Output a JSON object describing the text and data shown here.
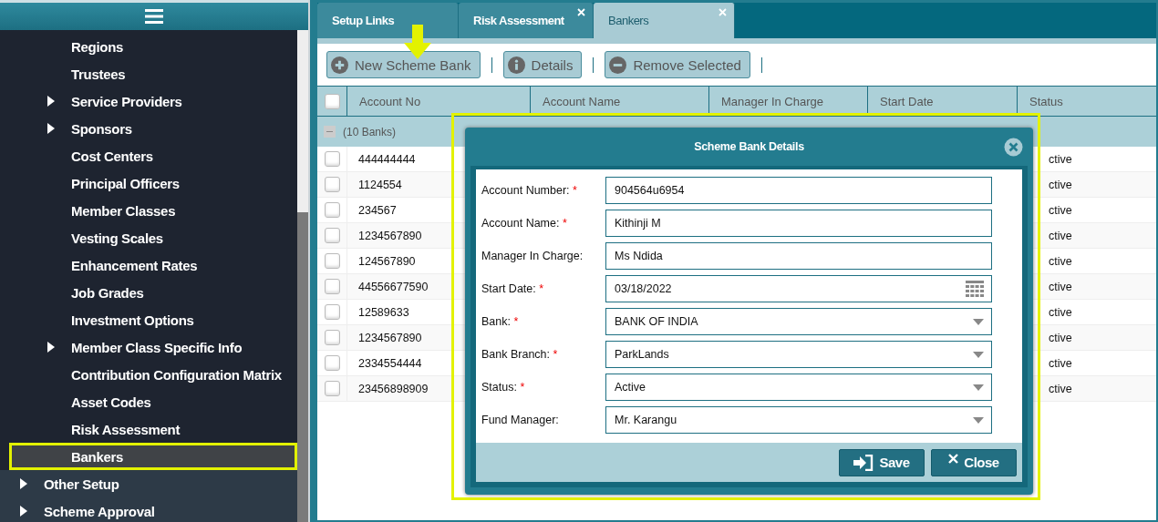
{
  "sidebar": {
    "sub_items": [
      {
        "label": "Regions",
        "expandable": false,
        "selected": false
      },
      {
        "label": "Trustees",
        "expandable": false,
        "selected": false
      },
      {
        "label": "Service Providers",
        "expandable": true,
        "selected": false
      },
      {
        "label": "Sponsors",
        "expandable": true,
        "selected": false
      },
      {
        "label": "Cost Centers",
        "expandable": false,
        "selected": false
      },
      {
        "label": "Principal Officers",
        "expandable": false,
        "selected": false
      },
      {
        "label": "Member Classes",
        "expandable": false,
        "selected": false
      },
      {
        "label": "Vesting Scales",
        "expandable": false,
        "selected": false
      },
      {
        "label": "Enhancement Rates",
        "expandable": false,
        "selected": false
      },
      {
        "label": "Job Grades",
        "expandable": false,
        "selected": false
      },
      {
        "label": "Investment Options",
        "expandable": false,
        "selected": false
      },
      {
        "label": "Member Class Specific Info",
        "expandable": true,
        "selected": false
      },
      {
        "label": "Contribution Configuration Matrix",
        "expandable": false,
        "selected": false
      },
      {
        "label": "Asset Codes",
        "expandable": false,
        "selected": false
      },
      {
        "label": "Risk Assessment",
        "expandable": false,
        "selected": false
      },
      {
        "label": "Bankers",
        "expandable": false,
        "selected": true
      }
    ],
    "items": [
      {
        "label": "Other Setup",
        "expandable": true
      },
      {
        "label": "Scheme Approval",
        "expandable": true
      }
    ]
  },
  "tabs": [
    {
      "label": "Setup Links",
      "closable": false,
      "selected": false
    },
    {
      "label": "Risk Assessment",
      "closable": true,
      "selected": false
    },
    {
      "label": "Bankers",
      "closable": true,
      "selected": true
    }
  ],
  "toolbar": [
    {
      "label": "New Scheme Bank",
      "kind": "add"
    },
    {
      "label": "Details",
      "kind": "info"
    },
    {
      "label": "Remove Selected",
      "kind": "remove"
    }
  ],
  "table": {
    "select_all_checked": false,
    "columns": [
      "Account No",
      "Account Name",
      "Manager In Charge",
      "Start Date",
      "Status"
    ],
    "group": "(10 Banks)",
    "rows": [
      {
        "account_no": "444444444",
        "status": "ctive",
        "checked": false
      },
      {
        "account_no": "1124554",
        "status": "ctive",
        "checked": false
      },
      {
        "account_no": "234567",
        "status": "ctive",
        "checked": false
      },
      {
        "account_no": "1234567890",
        "status": "ctive",
        "checked": false
      },
      {
        "account_no": "124567890",
        "status": "ctive",
        "checked": false
      },
      {
        "account_no": "44556677590",
        "status": "ctive",
        "checked": false
      },
      {
        "account_no": "12589633",
        "status": "ctive",
        "checked": false
      },
      {
        "account_no": "1234567890",
        "status": "ctive",
        "checked": false
      },
      {
        "account_no": "2334554444",
        "status": "ctive",
        "checked": false
      },
      {
        "account_no": "23456898909",
        "status": "ctive",
        "checked": false
      }
    ]
  },
  "dialog": {
    "title": "Scheme Bank Details",
    "fields": [
      {
        "label": "Account Number:",
        "required": true,
        "kind": "text",
        "value": "904564u6954"
      },
      {
        "label": "Account Name:",
        "required": true,
        "kind": "text",
        "value": "Kithinji M"
      },
      {
        "label": "Manager In Charge:",
        "required": false,
        "kind": "text",
        "value": "Ms Ndida"
      },
      {
        "label": "Start Date:",
        "required": true,
        "kind": "date",
        "value": "03/18/2022"
      },
      {
        "label": "Bank:",
        "required": true,
        "kind": "select",
        "value": "BANK OF INDIA"
      },
      {
        "label": "Bank Branch:",
        "required": true,
        "kind": "select",
        "value": "ParkLands"
      },
      {
        "label": "Status:",
        "required": true,
        "kind": "select",
        "value": "Active"
      },
      {
        "label": "Fund Manager:",
        "required": false,
        "kind": "select",
        "value": "Mr. Karangu"
      }
    ],
    "required_mark": "*",
    "buttons": [
      {
        "label": "Save",
        "kind": "save"
      },
      {
        "label": "Close",
        "kind": "close"
      }
    ]
  }
}
